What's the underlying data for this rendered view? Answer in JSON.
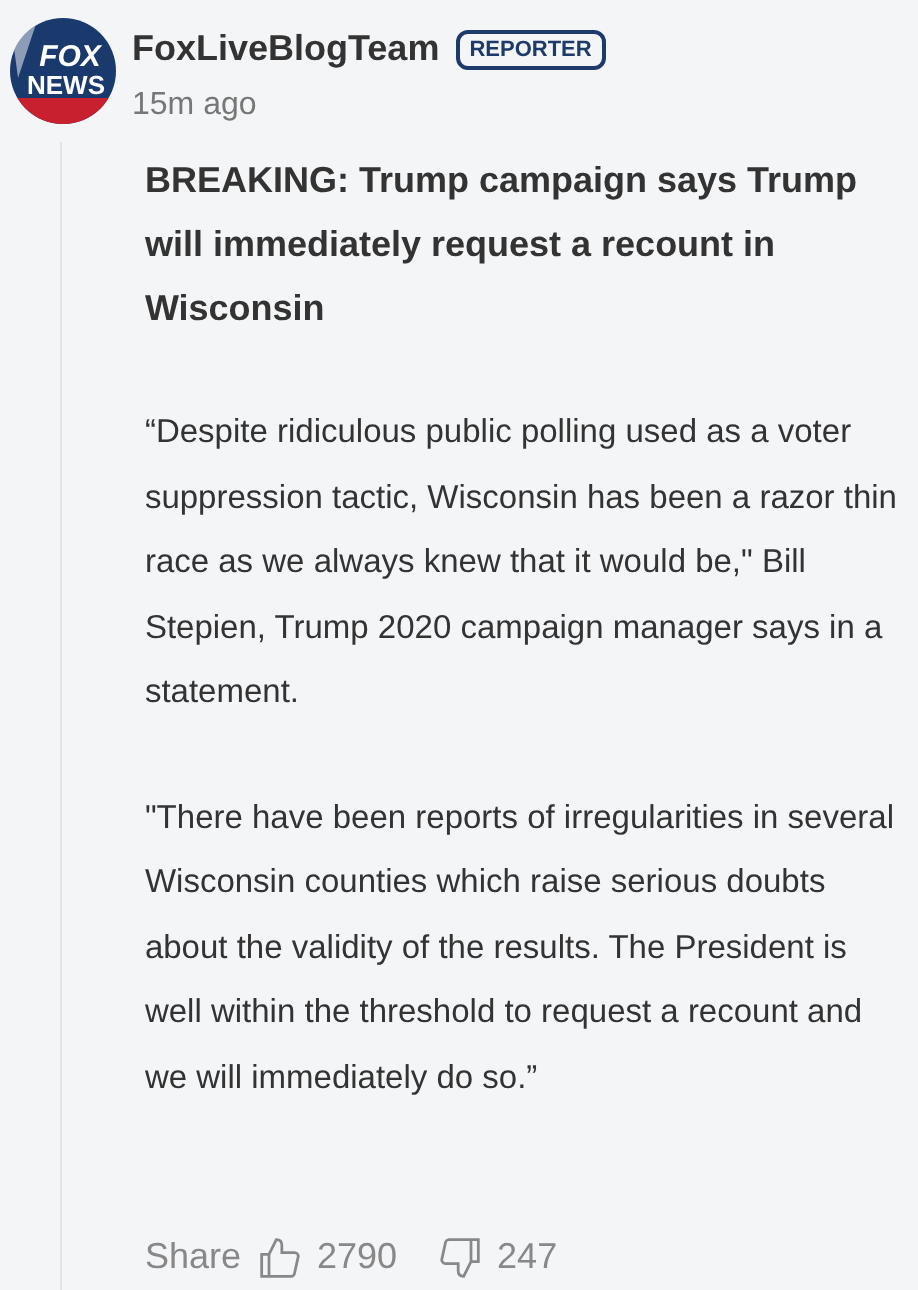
{
  "post": {
    "avatar_text": [
      "FOX",
      "NEWS"
    ],
    "author": "FoxLiveBlogTeam",
    "badge": "REPORTER",
    "time": "15m ago",
    "headline": "BREAKING: Trump campaign says Trump will immediately request a recount in Wisconsin",
    "paragraphs": [
      "“Despite ridiculous public polling used as a voter suppression tactic, Wisconsin has been a razor thin race as we always knew that it would be,\" Bill Stepien, Trump 2020 campaign manager says in a statement.",
      "\"There have been reports of irregularities in several Wisconsin counties which raise serious doubts about the validity of the results. The President is well within the threshold to request a recount and we will immediately do so.”"
    ],
    "footer": {
      "share": "Share",
      "likes": "2790",
      "dislikes": "247"
    }
  }
}
